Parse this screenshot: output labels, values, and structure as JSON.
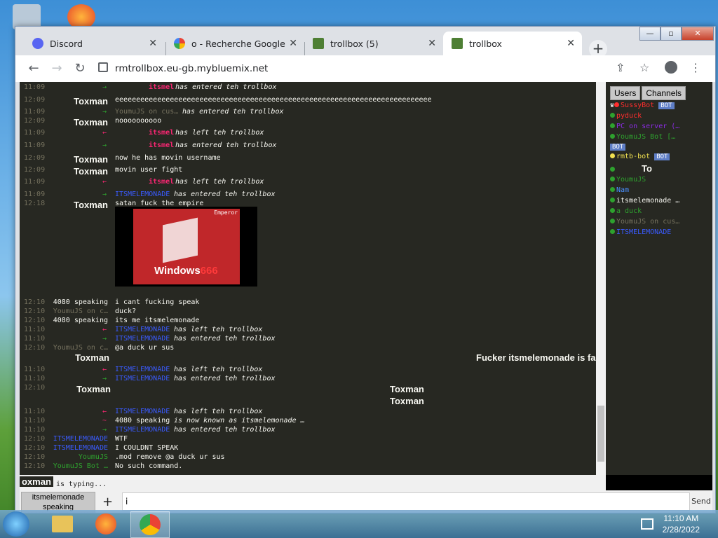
{
  "browser": {
    "tabs": [
      {
        "label": "Discord",
        "active": false
      },
      {
        "label": "o - Recherche Google",
        "active": false
      },
      {
        "label": "trollbox (5)",
        "active": false
      },
      {
        "label": "trollbox",
        "active": true
      }
    ],
    "url": "rmtrollbox.eu-gb.mybluemix.net"
  },
  "chat": {
    "rows": [
      {
        "ts": "11:09",
        "nick": "",
        "arrow": "→",
        "msg_user": "itsmel",
        "msg": "has entered teh trollbox"
      },
      {
        "ts": "12:09",
        "nick": "Toxman",
        "msg": "eeeeeeeeeeeeeeeeeeeeeeeeeeeeeeeeeeeeeeeeeeeeeeeeeeeeeeeeeeeeeeeeeeeeeeeeeee"
      },
      {
        "ts": "11:09",
        "nick": "",
        "arrow": "→",
        "msg_user": "YoumuJS on cus…",
        "msg": "has entered teh trollbox"
      },
      {
        "ts": "12:09",
        "nick": "Toxman",
        "msg": "noooooooooo"
      },
      {
        "ts": "11:09",
        "nick": "",
        "arrow": "←",
        "msg_user": "itsmel",
        "msg": "has left teh trollbox"
      },
      {
        "ts": "11:09",
        "nick": "",
        "arrow": "→",
        "msg_user": "itsmel",
        "msg": "has entered teh trollbox"
      },
      {
        "ts": "12:09",
        "nick": "Toxman",
        "msg": "now he has movin username"
      },
      {
        "ts": "12:09",
        "nick": "Toxman",
        "msg": "movin user fight"
      },
      {
        "ts": "11:09",
        "nick": "",
        "arrow": "←",
        "msg_user": "itsmel",
        "msg": "has left teh trollbox"
      },
      {
        "ts": "11:09",
        "nick": "",
        "arrow": "→",
        "msg_user": "ITSMELEMONADE",
        "msg": "has entered teh trollbox"
      },
      {
        "ts": "12:18",
        "nick": "Toxman",
        "msg": "satan fuck the empire"
      },
      {
        "ts": "12:10",
        "nick": "4080 speaking",
        "msg": "i cant fucking speak"
      },
      {
        "ts": "12:10",
        "nick": "YoumuJS on c…",
        "msg": "duck?"
      },
      {
        "ts": "12:10",
        "nick": "4080 speaking",
        "msg": "its me itsmelemonade"
      },
      {
        "ts": "11:10",
        "nick": "",
        "arrow": "←",
        "msg_user": "ITSMELEMONADE",
        "msg": "has left teh trollbox"
      },
      {
        "ts": "11:10",
        "nick": "",
        "arrow": "→",
        "msg_user": "ITSMELEMONADE",
        "msg": "has entered teh trollbox"
      },
      {
        "ts": "12:10",
        "nick": "YoumuJS on c…",
        "msg": "@a duck ur sus"
      },
      {
        "ts": "",
        "nick": "Toxman",
        "msg": "Fucker itsmelemonade is fa"
      },
      {
        "ts": "11:10",
        "nick": "",
        "arrow": "←",
        "msg_user": "ITSMELEMONADE",
        "msg": "has left teh trollbox"
      },
      {
        "ts": "11:10",
        "nick": "",
        "arrow": "→",
        "msg_user": "ITSMELEMONADE",
        "msg": "has entered teh trollbox"
      },
      {
        "ts": "12:10",
        "nick": "Toxman",
        "msg": "Toxman"
      },
      {
        "ts": "",
        "nick": "",
        "msg": "Toxman"
      },
      {
        "ts": "11:10",
        "nick": "",
        "arrow": "←",
        "msg_user": "ITSMELEMONADE",
        "msg": "has left teh trollbox"
      },
      {
        "ts": "11:10",
        "nick": "",
        "arrow": "~",
        "msg_user": "4080 speaking",
        "msg": "is now known as itsmelemonade …"
      },
      {
        "ts": "11:10",
        "nick": "",
        "arrow": "→",
        "msg_user": "ITSMELEMONADE",
        "msg": "has entered teh trollbox"
      },
      {
        "ts": "12:10",
        "nick": "ITSMELEMONADE",
        "msg": "WTF"
      },
      {
        "ts": "12:10",
        "nick": "ITSMELEMONADE",
        "msg": "I COULDNT SPEAK"
      },
      {
        "ts": "12:10",
        "nick": "YoumuJS",
        "msg": ".mod remove @a duck ur sus"
      },
      {
        "ts": "12:10",
        "nick": "YoumuJS Bot …",
        "msg": "No such command."
      }
    ],
    "image": {
      "banner": "Windows",
      "number": "666",
      "corner": "Emperor"
    }
  },
  "sidebar": {
    "tabs": [
      "Users",
      "Channels"
    ],
    "users": [
      {
        "name": "SussyBot",
        "color": "#ff2d2d",
        "bot": "BOT"
      },
      {
        "name": "pyduck",
        "color": "#ff2d2d"
      },
      {
        "name": "PC on server (…",
        "color": "#8a2be2"
      },
      {
        "name": "YoumuJS Bot […",
        "color": "#2ea12e",
        "bot": "BOT"
      },
      {
        "name": "rmtb-bot",
        "color": "#f0e050",
        "bot": "BOT"
      },
      {
        "name": "To",
        "color": "#f8f8f2"
      },
      {
        "name": "YoumuJS",
        "color": "#2ea12e"
      },
      {
        "name": "Nam",
        "color": "#4a90ff"
      },
      {
        "name": "itsmelemonade …",
        "color": "#f8f8f2"
      },
      {
        "name": "a duck",
        "color": "#2ea12e"
      },
      {
        "name": "YoumuJS on cus…",
        "color": "#75715e"
      },
      {
        "name": "ITSMELEMONADE",
        "color": "#3a5bff"
      }
    ]
  },
  "typing": {
    "user": "oxman",
    "text": "is typing..."
  },
  "input": {
    "channel": "itsmelemonade speaking",
    "value": "i",
    "send_label": "Send"
  },
  "taskbar": {
    "time": "11:10 AM",
    "date": "2/28/2022"
  }
}
